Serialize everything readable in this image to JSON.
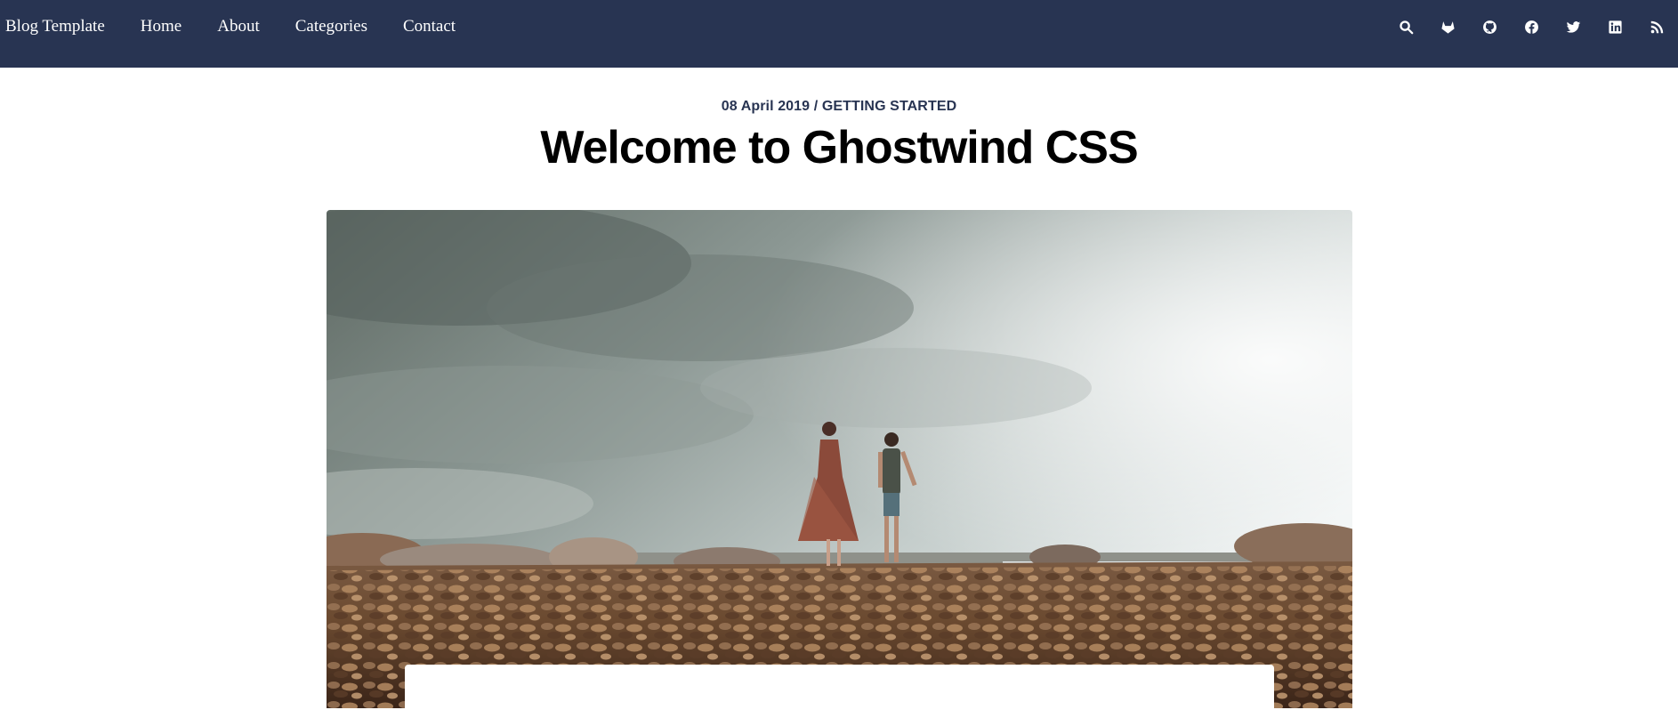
{
  "nav": {
    "brand": "Blog Template",
    "links": [
      "Home",
      "About",
      "Categories",
      "Contact"
    ],
    "icons": [
      "search-icon",
      "gitlab-icon",
      "github-icon",
      "facebook-icon",
      "twitter-icon",
      "linkedin-icon",
      "rss-icon"
    ]
  },
  "post": {
    "date": "08 April 2019",
    "separator": " / ",
    "category": "GETTING STARTED",
    "title": "Welcome to Ghostwind CSS"
  },
  "colors": {
    "nav_bg": "#283452",
    "meta_text": "#283452",
    "title_text": "#000000"
  }
}
